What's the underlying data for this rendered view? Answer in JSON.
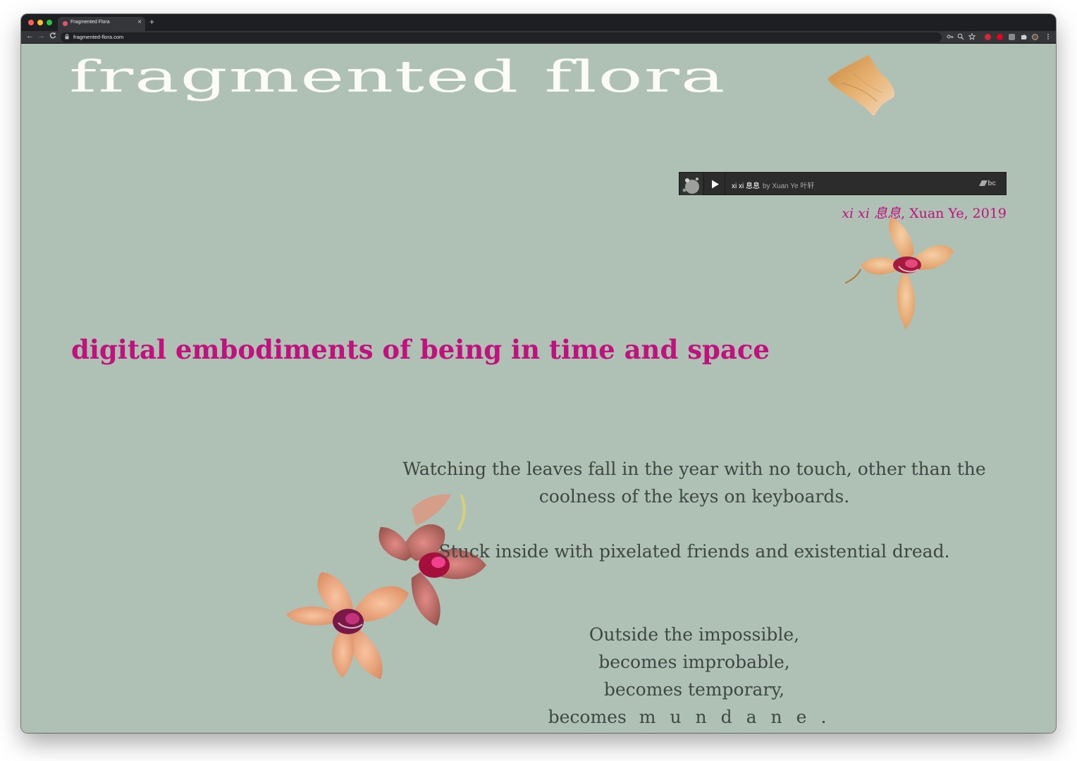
{
  "browser": {
    "tab_title": "Fragmented Flora",
    "tab_close": "×",
    "new_tab": "+",
    "url": "fragmented-flora.com",
    "nav": {
      "back": "←",
      "forward": "→",
      "reload": "C"
    }
  },
  "site": {
    "title": "fragmented flora",
    "tagline": "digital embodiments of being in time and space"
  },
  "player": {
    "track": "xi xi 息息",
    "by_artist": "by Xuan Ye 叶轩",
    "logo": "bc"
  },
  "caption": {
    "title": "xi xi 息息",
    "rest": ", Xuan Ye, 2019"
  },
  "poem": {
    "stanza1": [
      "Watching the leaves fall in the year with no touch, other than the",
      "coolness of the keys on keyboards."
    ],
    "stanza2": "Stuck inside with pixelated friends and existential dread.",
    "stanza3": [
      "Outside the impossible,",
      "becomes improbable,",
      "becomes temporary,"
    ],
    "last_prefix": "becomes",
    "last_word": "mundane."
  },
  "colors": {
    "background": "#afc0b5",
    "accent": "#c0117d",
    "title": "#fbfbf7",
    "body_text": "#3f4744"
  }
}
